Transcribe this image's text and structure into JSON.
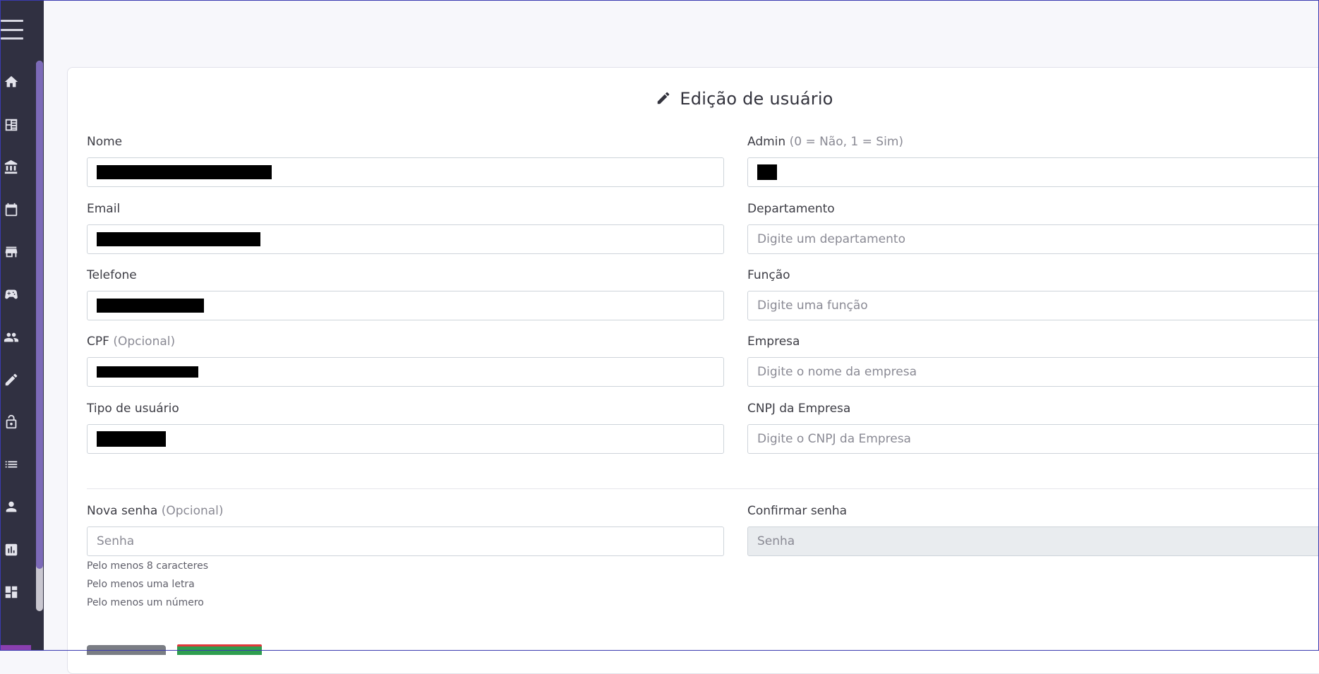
{
  "form": {
    "title": "Edição de usuário",
    "title_icon": "pencil-icon",
    "left": {
      "nome": {
        "label": "Nome"
      },
      "email": {
        "label": "Email"
      },
      "telefone": {
        "label": "Telefone"
      },
      "cpf": {
        "label": "CPF",
        "label_note": "(Opcional)"
      },
      "tipo": {
        "label": "Tipo de usuário"
      }
    },
    "right": {
      "admin": {
        "label": "Admin",
        "label_note": "(0 = Não, 1 = Sim)"
      },
      "departamento": {
        "label": "Departamento",
        "placeholder": "Digite um departamento"
      },
      "funcao": {
        "label": "Função",
        "placeholder": "Digite uma função"
      },
      "empresa": {
        "label": "Empresa",
        "placeholder": "Digite o nome da empresa"
      },
      "cnpj": {
        "label": "CNPJ da Empresa",
        "placeholder": "Digite o CNPJ da Empresa"
      }
    },
    "password": {
      "new_label": "Nova senha",
      "new_label_note": "(Opcional)",
      "new_placeholder": "Senha",
      "confirm_label": "Confirmar senha",
      "confirm_placeholder": "Senha",
      "hints": [
        "Pelo menos 8 caracteres",
        "Pelo menos uma letra",
        "Pelo menos um número"
      ]
    }
  },
  "sidebar": {
    "icons": [
      "menu-icon",
      "home-icon",
      "dashboard-list-icon",
      "bank-icon",
      "calendar-icon",
      "store-icon",
      "gamepad-icon",
      "group-icon",
      "pencil-icon",
      "lock-open-icon",
      "list-icon",
      "person-icon",
      "bar-chart-icon",
      "dashboard-icon"
    ]
  },
  "colors": {
    "sidebar_bg": "#303041",
    "scroll_thumb": "#7c6ab8",
    "save_button": "#2e9e4f",
    "secondary_button": "#7a7d84"
  }
}
